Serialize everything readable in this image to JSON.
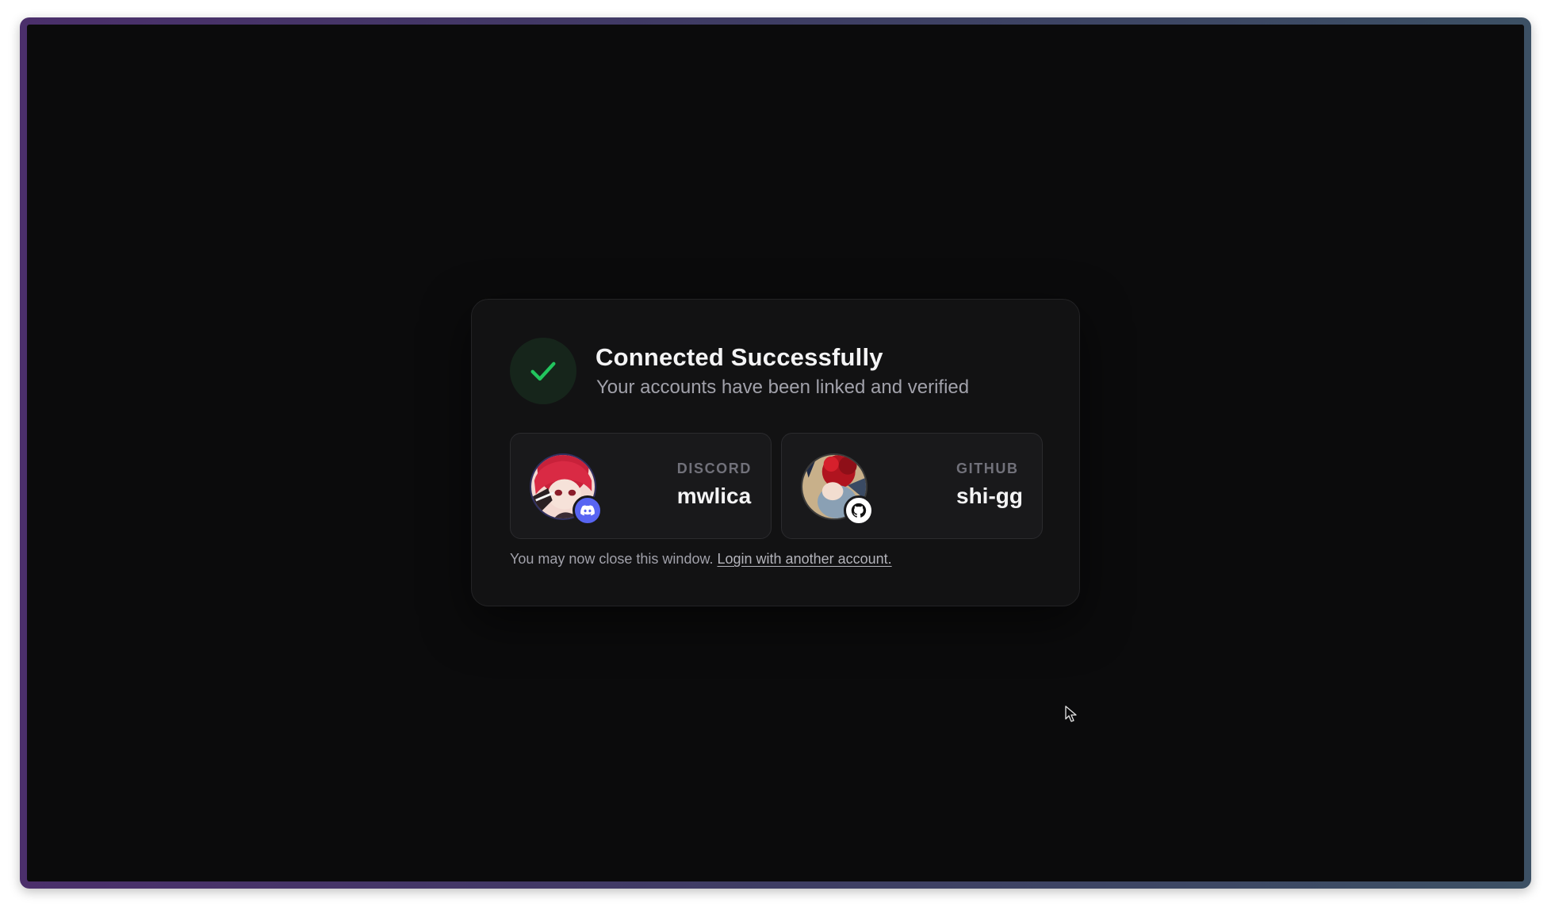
{
  "card": {
    "title": "Connected Successfully",
    "subtitle": "Your accounts have been linked and verified",
    "status_icon": "checkmark-icon",
    "status_color": "#22c55e"
  },
  "accounts": [
    {
      "service": "DISCORD",
      "username": "mwlica",
      "badge_icon": "discord-icon",
      "badge_color": "#5865f2"
    },
    {
      "service": "GITHUB",
      "username": "shi-gg",
      "badge_icon": "github-icon",
      "badge_color": "#ffffff"
    }
  ],
  "footer": {
    "text": "You may now close this window.",
    "link_label": "Login with another account."
  },
  "colors": {
    "background": "#0b0b0c",
    "card": "#121213",
    "frame_gradient": [
      "#4b2f6b",
      "#3c5064"
    ]
  }
}
